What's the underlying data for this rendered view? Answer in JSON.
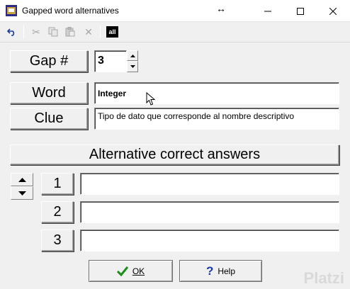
{
  "window": {
    "title": "Gapped word alternatives",
    "icons": [
      "app-icon",
      "resize-arrows-icon",
      "minimize-icon",
      "maximize-icon",
      "close-icon"
    ]
  },
  "toolbar": {
    "icons": [
      "undo-icon",
      "cut-icon",
      "copy-icon",
      "paste-icon",
      "delete-icon",
      "select-all-icon"
    ],
    "all_label": "all"
  },
  "gap": {
    "label": "Gap #",
    "value": "3"
  },
  "word": {
    "label": "Word",
    "value": "Integer"
  },
  "clue": {
    "label": "Clue",
    "value": "Tipo de dato que corresponde al nombre descriptivo"
  },
  "alternatives": {
    "header": "Alternative correct answers",
    "rows": [
      {
        "number": "1",
        "value": ""
      },
      {
        "number": "2",
        "value": ""
      },
      {
        "number": "3",
        "value": ""
      }
    ]
  },
  "buttons": {
    "ok": "OK",
    "help": "Help"
  },
  "watermark": "Platzi",
  "colors": {
    "ok_check": "#1a8c1a",
    "help_mark": "#1a3aa8",
    "app_icon_bg": "#2a2a8a"
  }
}
